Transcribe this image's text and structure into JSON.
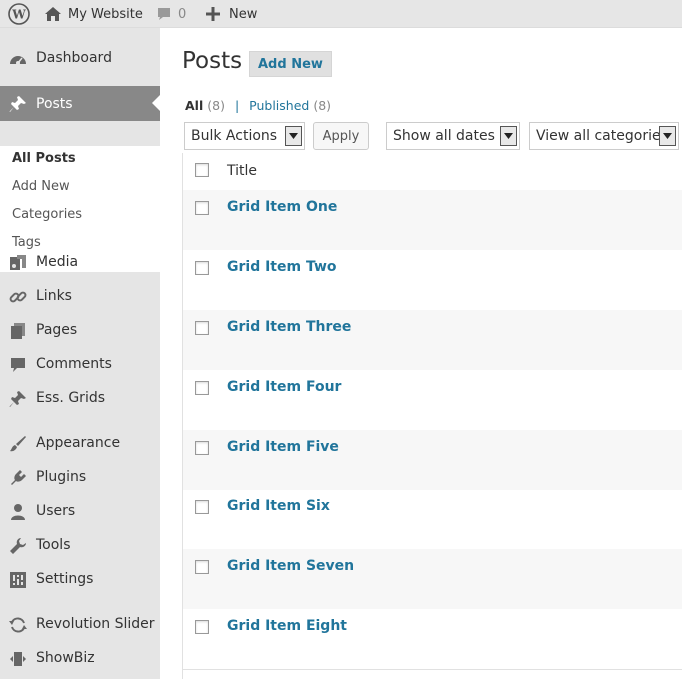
{
  "adminbar": {
    "site_name": "My Website",
    "comments_count": "0",
    "new_label": "New"
  },
  "sidebar": {
    "items": [
      {
        "label": "Dashboard",
        "icon": "dashboard-icon"
      },
      {
        "label": "Posts",
        "icon": "pushpin-icon"
      },
      {
        "label": "Media",
        "icon": "media-icon"
      },
      {
        "label": "Links",
        "icon": "link-icon"
      },
      {
        "label": "Pages",
        "icon": "pages-icon"
      },
      {
        "label": "Comments",
        "icon": "comment-icon"
      },
      {
        "label": "Ess. Grids",
        "icon": "pushpin-icon"
      },
      {
        "label": "Appearance",
        "icon": "paintbrush-icon"
      },
      {
        "label": "Plugins",
        "icon": "plug-icon"
      },
      {
        "label": "Users",
        "icon": "user-icon"
      },
      {
        "label": "Tools",
        "icon": "wrench-icon"
      },
      {
        "label": "Settings",
        "icon": "sliders-icon"
      },
      {
        "label": "Revolution Slider",
        "icon": "refresh-icon"
      },
      {
        "label": "ShowBiz",
        "icon": "showbiz-icon"
      }
    ],
    "submenu": [
      "All Posts",
      "Add New",
      "Categories",
      "Tags"
    ]
  },
  "main": {
    "title": "Posts",
    "add_new": "Add New",
    "filters": {
      "all_label": "All",
      "all_count": "(8)",
      "separator": "|",
      "published_label": "Published",
      "published_count": "(8)"
    },
    "bulk_actions": "Bulk Actions",
    "apply": "Apply",
    "dates": "Show all dates",
    "categories": "View all categories",
    "table": {
      "column_title": "Title",
      "rows": [
        "Grid Item One",
        "Grid Item Two",
        "Grid Item Three",
        "Grid Item Four",
        "Grid Item Five",
        "Grid Item Six",
        "Grid Item Seven",
        "Grid Item Eight"
      ]
    }
  },
  "colors": {
    "link": "#21759b",
    "sidebar_bg": "#e5e5e5",
    "active_bg": "#888888"
  }
}
